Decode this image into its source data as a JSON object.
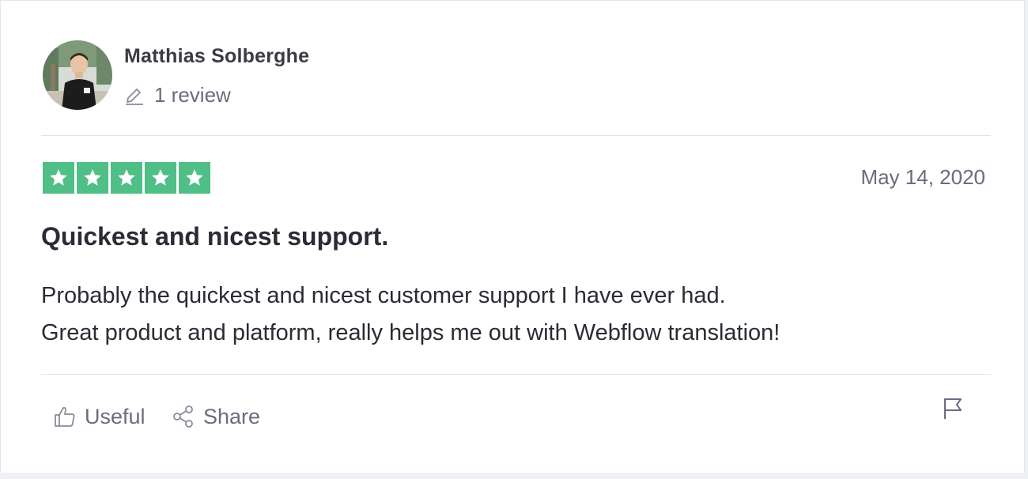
{
  "consumer": {
    "name": "Matthias Solberghe",
    "reviews_count": "1 review",
    "avatar_icon": "user-avatar-photo",
    "reviews_icon": "pencil-icon"
  },
  "review": {
    "rating": 5,
    "rating_max": 5,
    "date": "May 14, 2020",
    "title": "Quickest and nicest support.",
    "text_lines": [
      "Probably the quickest and nicest customer support I have ever had.",
      "Great product and platform, really helps me out with Webflow translation!"
    ]
  },
  "actions": {
    "useful_label": "Useful",
    "useful_icon": "thumbs-up-icon",
    "share_label": "Share",
    "share_icon": "share-icon",
    "flag_icon": "flag-icon"
  },
  "colors": {
    "star_green": "#4fbe87",
    "text_dark": "#2b2b35",
    "text_muted": "#6b6b80"
  }
}
